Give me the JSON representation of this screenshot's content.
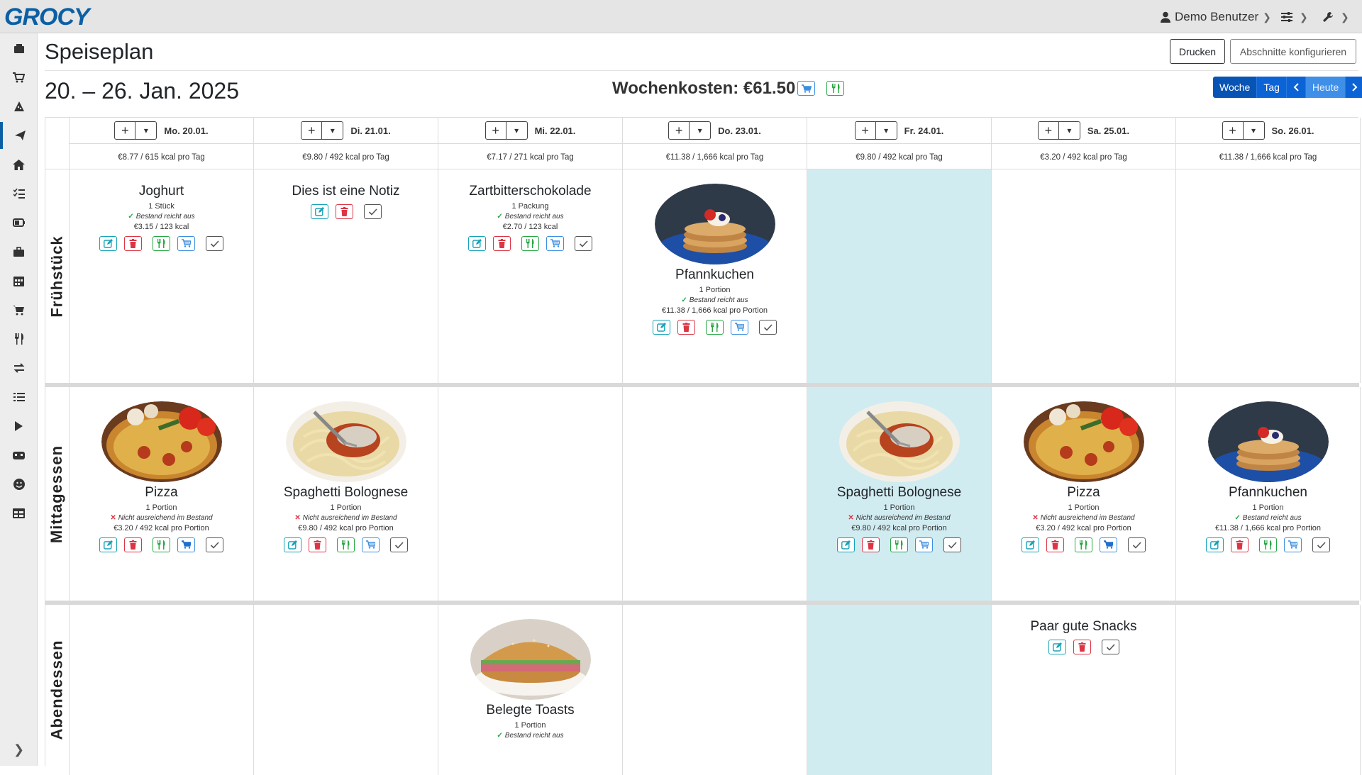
{
  "app": {
    "logo": "GROCY"
  },
  "topbar": {
    "user": "Demo Benutzer"
  },
  "page": {
    "title": "Speiseplan",
    "print_button": "Drucken",
    "sections_button": "Abschnitte konfigurieren",
    "date_range": "20. – 26. Jan. 2025",
    "weekly_cost": "Wochenkosten: €61.50",
    "view_switch": {
      "week": "Woche",
      "day": "Tag",
      "today": "Heute"
    }
  },
  "sidebar": {
    "items": [
      "box-icon",
      "cart-icon",
      "recipe-icon",
      "meal-plan-icon",
      "home-icon",
      "checklist-icon",
      "battery-icon",
      "toolbox-icon",
      "calendar-icon",
      "shopping-cart-icon",
      "cutlery-icon",
      "transfer-icon",
      "list-icon",
      "play-icon",
      "barcode-icon",
      "smiley-icon",
      "table-icon"
    ],
    "active": "meal-plan-icon"
  },
  "days": [
    {
      "label": "Mo. 20.01.",
      "summary": "€8.77 / 615 kcal pro Tag"
    },
    {
      "label": "Di. 21.01.",
      "summary": "€9.80 / 492 kcal pro Tag"
    },
    {
      "label": "Mi. 22.01.",
      "summary": "€7.17 / 271 kcal pro Tag"
    },
    {
      "label": "Do. 23.01.",
      "summary": "€11.38 / 1,666 kcal pro Tag"
    },
    {
      "label": "Fr. 24.01.",
      "summary": "€9.80 / 492 kcal pro Tag"
    },
    {
      "label": "Sa. 25.01.",
      "summary": "€3.20 / 492 kcal pro Tag"
    },
    {
      "label": "So. 26.01.",
      "summary": "€11.38 / 1,666 kcal pro Tag"
    }
  ],
  "sections": [
    "Frühstück",
    "Mittagessen",
    "Abendessen"
  ],
  "entries": {
    "joghurt": {
      "name": "Joghurt",
      "amount": "1 Stück",
      "stock": "Bestand reicht aus",
      "cost": "€3.15 / 123 kcal"
    },
    "note": {
      "name": "Dies ist eine Notiz"
    },
    "chocolate": {
      "name": "Zartbitterschokolade",
      "amount": "1 Packung",
      "stock": "Bestand reicht aus",
      "cost": "€2.70 / 123 kcal"
    },
    "pancake_thu": {
      "name": "Pfannkuchen",
      "amount": "1 Portion",
      "stock": "Bestand reicht aus",
      "cost": "€11.38 / 1,666 kcal pro Portion"
    },
    "pizza_mon": {
      "name": "Pizza",
      "amount": "1 Portion",
      "stock": "Nicht ausreichend im Bestand",
      "cost": "€3.20 / 492 kcal pro Portion"
    },
    "spaghetti_tue": {
      "name": "Spaghetti Bolognese",
      "amount": "1 Portion",
      "stock": "Nicht ausreichend im Bestand",
      "cost": "€9.80 / 492 kcal pro Portion"
    },
    "spaghetti_fri": {
      "name": "Spaghetti Bolognese",
      "amount": "1 Portion",
      "stock": "Nicht ausreichend im Bestand",
      "cost": "€9.80 / 492 kcal pro Portion"
    },
    "pizza_sat": {
      "name": "Pizza",
      "amount": "1 Portion",
      "stock": "Nicht ausreichend im Bestand",
      "cost": "€3.20 / 492 kcal pro Portion"
    },
    "pancake_sun": {
      "name": "Pfannkuchen",
      "amount": "1 Portion",
      "stock": "Bestand reicht aus",
      "cost": "€11.38 / 1,666 kcal pro Portion"
    },
    "toasts": {
      "name": "Belegte Toasts",
      "amount": "1 Portion",
      "stock": "Bestand reicht aus"
    },
    "snacks": {
      "name": "Paar gute Snacks"
    }
  }
}
